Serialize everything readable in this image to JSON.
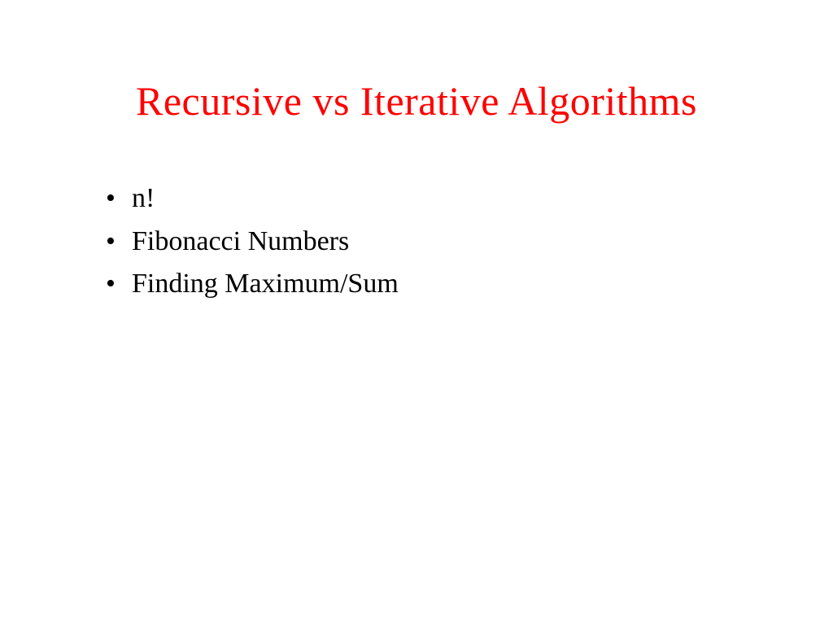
{
  "title": "Recursive vs Iterative Algorithms",
  "bullets": {
    "item0": "n!",
    "item1": "Fibonacci Numbers",
    "item2": "Finding Maximum/Sum"
  }
}
